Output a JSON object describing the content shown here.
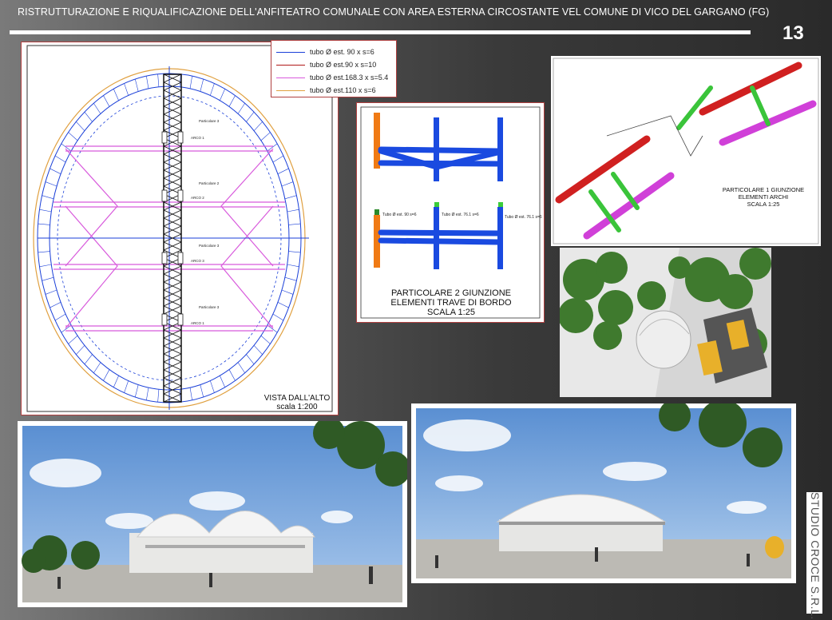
{
  "header": {
    "title": "RISTRUTTURAZIONE E RIQUALIFICAZIONE DELL'ANFITEATRO COMUNALE CON AREA ESTERNA CIRCOSTANTE VEL COMUNE DI VICO DEL GARGANO (FG)",
    "page_number": "13"
  },
  "side_label": "STUDIO CROCE S.R.L.",
  "plan": {
    "legend": [
      {
        "label": "tubo Ø est. 90 x s=6",
        "color": "#1a3fd8"
      },
      {
        "label": "tubo Ø est.90 x s=10",
        "color": "#b01818"
      },
      {
        "label": "tubo Ø est.168.3 x s=5.4",
        "color": "#d85adc"
      },
      {
        "label": "tubo Ø est.110 x s=6",
        "color": "#e0a040"
      }
    ],
    "caption_line1": "VISTA DALL'ALTO",
    "caption_line2": "scala 1:200",
    "arch_labels": [
      "ARCO 1",
      "ARCO 2",
      "ARCO 3",
      "ARCO 1"
    ],
    "part_labels": [
      "Particolare 3",
      "Particolare 2",
      "Particolare 3",
      "Particolare 3"
    ]
  },
  "detail2": {
    "caption_line1": "PARTICOLARE 2 GIUNZIONE",
    "caption_line2": "ELEMENTI TRAVE DI BORDO",
    "caption_line3": "SCALA 1:25",
    "tube_labels": [
      "Tubo Ø est. 90 s=6",
      "Tubo Ø est. 76.1 s=6",
      "Tubo Ø est. 76.1 s=6"
    ]
  },
  "detail1": {
    "caption_line1": "PARTICOLARE 1 GIUNZIONE",
    "caption_line2": "ELEMENTI ARCHI",
    "caption_line3": "SCALA 1:25"
  }
}
